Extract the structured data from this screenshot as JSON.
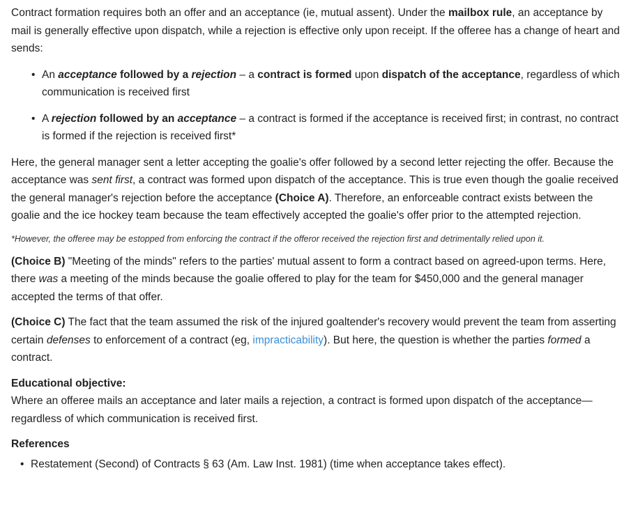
{
  "intro": {
    "t1": "Contract formation requires both an offer and an acceptance (ie, mutual assent).  Under the ",
    "b1": "mailbox rule",
    "t2": ", an acceptance by mail is generally effective upon dispatch, while a rejection is effective only upon receipt.  If the offeree has a change of heart and sends:"
  },
  "rules": {
    "bullet": "•",
    "r1": {
      "t1": "An ",
      "bi1": "acceptance",
      "b1": " followed by a ",
      "bi2": "rejection",
      "t2": " – a ",
      "b2": "contract is formed",
      "t3": " upon ",
      "b3": "dispatch of the acceptance",
      "t4": ", regardless of which communication is received first"
    },
    "r2": {
      "t1": "A ",
      "bi1": "rejection",
      "b1": " followed by an ",
      "bi2": "acceptance",
      "t2": " – a contract is formed if the acceptance is received first; in contrast, no contract is formed if the rejection is received first*"
    }
  },
  "analysis": {
    "t1": "Here, the general manager sent a letter accepting the goalie's offer followed by a second letter rejecting the offer.  Because the acceptance was ",
    "i1": "sent first",
    "t2": ", a contract was formed upon dispatch of the acceptance.  This is true even though the goalie received the general manager's rejection before the acceptance ",
    "b1": "(Choice A)",
    "t3": ".  Therefore, an enforceable contract exists between the goalie and the ice hockey team because the team effectively accepted the goalie's offer prior to the attempted rejection."
  },
  "footnote": "*However, the offeree may be estopped from enforcing the contract if the offeror received the rejection first and detrimentally relied upon it.",
  "choice_b": {
    "label": "(Choice B)",
    "t1": "  \"Meeting of the minds\" refers to the parties' mutual assent to form a contract based on agreed-upon terms.  Here, there ",
    "i1": "was",
    "t2": " a meeting of the minds because the goalie offered to play for the team for $450,000 and the general manager accepted the terms of that offer."
  },
  "choice_c": {
    "label": "(Choice C)",
    "t1": "  The fact that the team assumed the risk of the injured goaltender's recovery would prevent the team from asserting certain ",
    "i1": "defenses",
    "t2": " to enforcement of a contract (eg, ",
    "link": "impracticability",
    "t3": ").  But here, the question is whether the parties ",
    "i2": "formed",
    "t4": " a contract."
  },
  "objective": {
    "heading": "Educational objective:",
    "text": "Where an offeree mails an acceptance and later mails a rejection, a contract is formed upon dispatch of the acceptance—regardless of which communication is received first."
  },
  "references": {
    "heading": "References",
    "bullet": "•",
    "items": [
      "Restatement (Second) of Contracts § 63 (Am. Law Inst. 1981) (time when acceptance takes effect)."
    ]
  },
  "colors": {
    "text": "#222222",
    "link": "#3a8fd6"
  }
}
